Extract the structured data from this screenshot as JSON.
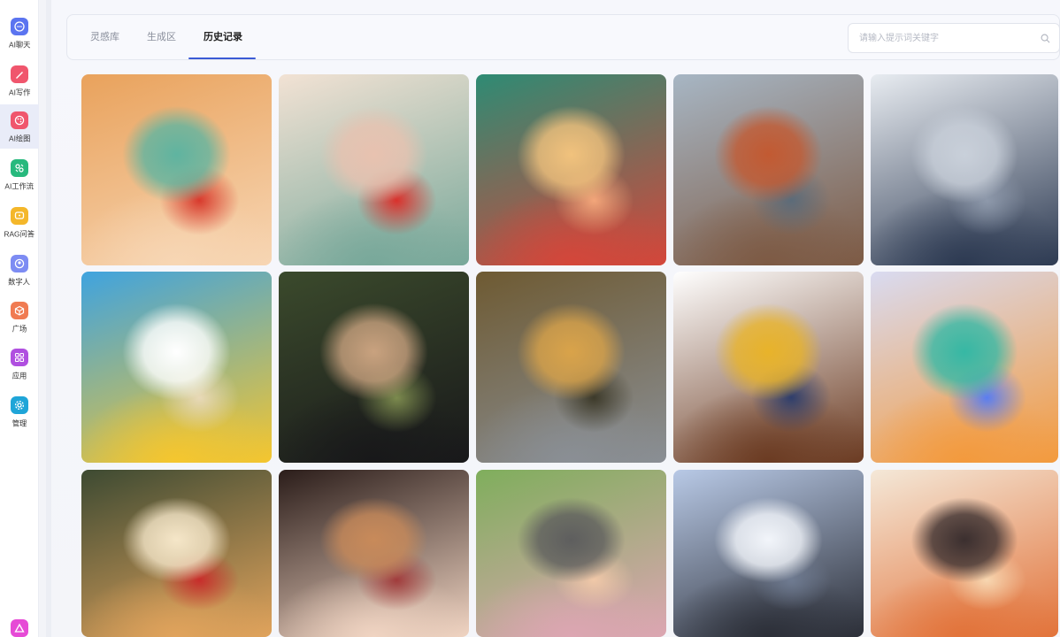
{
  "sidebar": {
    "items": [
      {
        "label": "AI聊天",
        "icon": "chat-bubble-icon",
        "color": "#5b74f0",
        "glyph": "💬",
        "active": false
      },
      {
        "label": "AI写作",
        "icon": "pen-icon",
        "color": "#f0566d",
        "glyph": "✎",
        "active": false
      },
      {
        "label": "AI绘图",
        "icon": "palette-icon",
        "color": "#f0566d",
        "glyph": "✿",
        "active": true
      },
      {
        "label": "AI工作流",
        "icon": "workflow-icon",
        "color": "#27b97d",
        "glyph": "⚙",
        "active": false
      },
      {
        "label": "RAG问答",
        "icon": "qa-icon",
        "color": "#f4b72a",
        "glyph": "?",
        "active": false
      },
      {
        "label": "数字人",
        "icon": "digital-human-icon",
        "color": "#7d8cf3",
        "glyph": "☺",
        "active": false
      },
      {
        "label": "广场",
        "icon": "cube-icon",
        "color": "#f07b52",
        "glyph": "◈",
        "active": false
      },
      {
        "label": "应用",
        "icon": "apps-grid-icon",
        "color": "#b04fe0",
        "glyph": "▦",
        "active": false
      },
      {
        "label": "管理",
        "icon": "settings-icon",
        "color": "#1fa5d8",
        "glyph": "✱",
        "active": false
      }
    ],
    "bottom_icon": {
      "icon": "app-logo-icon",
      "color": "#e64ad6"
    }
  },
  "tabs": [
    {
      "label": "灵感库",
      "active": false
    },
    {
      "label": "生成区",
      "active": false
    },
    {
      "label": "历史记录",
      "active": true
    }
  ],
  "search": {
    "placeholder": "请输入提示词关键字",
    "value": ""
  },
  "gallery": {
    "images": [
      {
        "name": "anime-girl-apple-1",
        "palette": [
          "#e9a25c",
          "#f7d6b4",
          "#5fb4a0",
          "#d83a2d"
        ]
      },
      {
        "name": "anime-girl-apple-2",
        "palette": [
          "#f2e2d4",
          "#78a89a",
          "#e8c2b0",
          "#d9312c"
        ]
      },
      {
        "name": "anime-girl-flowers",
        "palette": [
          "#2e8b74",
          "#d4463a",
          "#f1c27d",
          "#f3a67a"
        ]
      },
      {
        "name": "steampunk-airship",
        "palette": [
          "#a7b6c4",
          "#7d5a44",
          "#c25a32",
          "#5c6b79"
        ]
      },
      {
        "name": "office-workers",
        "palette": [
          "#e8ecf1",
          "#2d3a52",
          "#c9d0da",
          "#8e99ab"
        ]
      },
      {
        "name": "sunflower-beach",
        "palette": [
          "#3fa3df",
          "#f5c62e",
          "#ffffff",
          "#e8d9b8"
        ]
      },
      {
        "name": "woman-running-black",
        "palette": [
          "#3b4a2c",
          "#18181a",
          "#c9a27f",
          "#7c8a4e"
        ]
      },
      {
        "name": "woman-running-grey",
        "palette": [
          "#6e5a32",
          "#8a8f95",
          "#d9a34a",
          "#3d3a2a"
        ]
      },
      {
        "name": "cartoon-boy-glasses",
        "palette": [
          "#ffffff",
          "#6b3b22",
          "#e8b32a",
          "#2f3e6b"
        ]
      },
      {
        "name": "3d-headphone-character",
        "palette": [
          "#d9dbf1",
          "#f39a3d",
          "#36b8a4",
          "#5a7ef0"
        ]
      },
      {
        "name": "hamster-milkshake",
        "palette": [
          "#3d4a32",
          "#e0a35c",
          "#f5e6c8",
          "#c82d2b"
        ]
      },
      {
        "name": "hanfu-girl",
        "palette": [
          "#2b1d1a",
          "#f0d4c2",
          "#c88a5a",
          "#a13c3c"
        ]
      },
      {
        "name": "woman-running-park",
        "palette": [
          "#7fae5c",
          "#dca6b2",
          "#5e5e5e",
          "#f0c8a8"
        ]
      },
      {
        "name": "anime-boy-jacket",
        "palette": [
          "#b8c9e6",
          "#2c2f38",
          "#f2f5fa",
          "#6f7b91"
        ]
      },
      {
        "name": "fox-girl-stickers",
        "palette": [
          "#f4e8d8",
          "#e2733a",
          "#3b2f2f",
          "#f7d6b0"
        ]
      }
    ]
  }
}
